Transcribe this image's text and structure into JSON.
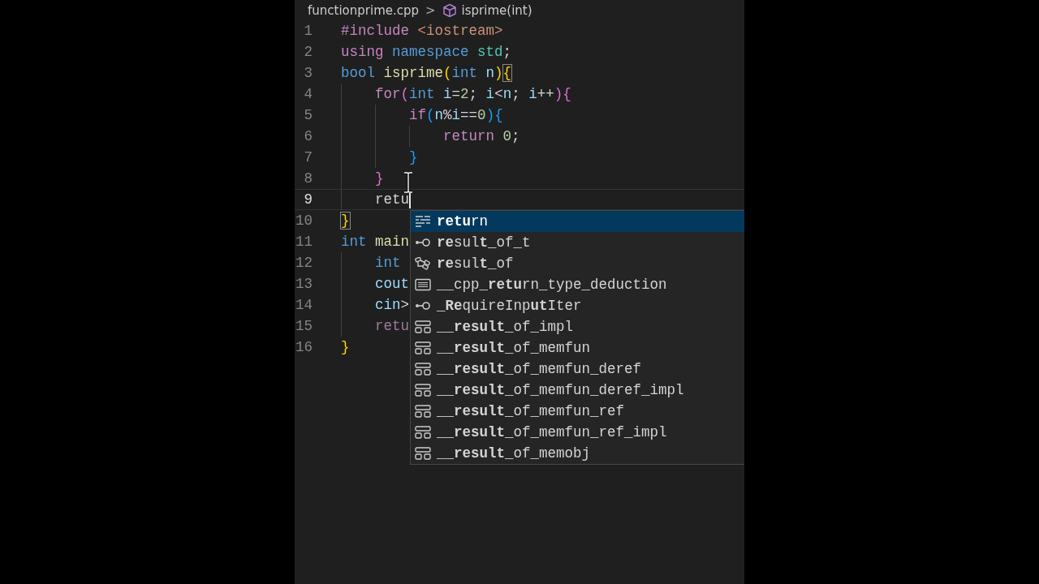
{
  "breadcrumb": {
    "file": "functionprime.cpp",
    "separator": ">",
    "symbol": "isprime(int)"
  },
  "lines": [
    {
      "number": "1",
      "current": false,
      "tokens": [
        {
          "text": "#include",
          "kind": "keyword"
        },
        {
          "text": " <iostream>",
          "kind": "string"
        }
      ]
    },
    {
      "number": "2",
      "current": false,
      "tokens": [
        {
          "text": "using",
          "kind": "keyword"
        },
        {
          "text": " namespace",
          "kind": "type"
        },
        {
          "text": " std",
          "kind": "namespace"
        },
        {
          "text": ";",
          "kind": "plain"
        }
      ]
    },
    {
      "number": "3",
      "current": false,
      "tokens": [
        {
          "text": "bool",
          "kind": "type"
        },
        {
          "text": " isprime",
          "kind": "function"
        },
        {
          "text": "(",
          "kind": "bracket1"
        },
        {
          "text": "int",
          "kind": "type"
        },
        {
          "text": " n",
          "kind": "variable"
        },
        {
          "text": ")",
          "kind": "bracket1"
        },
        {
          "text": "{",
          "kind": "matched-bracket"
        }
      ]
    },
    {
      "number": "4",
      "current": false,
      "tokens": [
        {
          "text": "    for",
          "kind": "keyword"
        },
        {
          "text": "(",
          "kind": "bracket2"
        },
        {
          "text": "int",
          "kind": "type"
        },
        {
          "text": " i",
          "kind": "variable"
        },
        {
          "text": "=",
          "kind": "plain"
        },
        {
          "text": "2",
          "kind": "number"
        },
        {
          "text": "; ",
          "kind": "plain"
        },
        {
          "text": "i",
          "kind": "variable"
        },
        {
          "text": "<",
          "kind": "plain"
        },
        {
          "text": "n",
          "kind": "variable"
        },
        {
          "text": "; ",
          "kind": "plain"
        },
        {
          "text": "i",
          "kind": "variable"
        },
        {
          "text": "++",
          "kind": "plain"
        },
        {
          "text": "){",
          "kind": "bracket2"
        }
      ]
    },
    {
      "number": "5",
      "current": false,
      "tokens": [
        {
          "text": "        if",
          "kind": "keyword"
        },
        {
          "text": "(",
          "kind": "bracket3"
        },
        {
          "text": "n",
          "kind": "variable"
        },
        {
          "text": "%",
          "kind": "plain"
        },
        {
          "text": "i",
          "kind": "variable"
        },
        {
          "text": "==",
          "kind": "plain"
        },
        {
          "text": "0",
          "kind": "number"
        },
        {
          "text": "){",
          "kind": "bracket3"
        }
      ]
    },
    {
      "number": "6",
      "current": false,
      "tokens": [
        {
          "text": "            return",
          "kind": "keyword"
        },
        {
          "text": " 0",
          "kind": "number"
        },
        {
          "text": ";",
          "kind": "plain"
        }
      ]
    },
    {
      "number": "7",
      "current": false,
      "tokens": [
        {
          "text": "        }",
          "kind": "bracket3"
        }
      ]
    },
    {
      "number": "8",
      "current": false,
      "tokens": [
        {
          "text": "    }",
          "kind": "bracket2"
        }
      ]
    },
    {
      "number": "9",
      "current": true,
      "tokens": [
        {
          "text": "    retu",
          "kind": "plain"
        }
      ]
    },
    {
      "number": "10",
      "current": false,
      "tokens": [
        {
          "text": "}",
          "kind": "matched-bracket"
        }
      ]
    },
    {
      "number": "11",
      "current": false,
      "tokens": [
        {
          "text": "int",
          "kind": "type"
        },
        {
          "text": " main",
          "kind": "function"
        }
      ]
    },
    {
      "number": "12",
      "current": false,
      "tokens": [
        {
          "text": "    int",
          "kind": "type"
        }
      ]
    },
    {
      "number": "13",
      "current": false,
      "tokens": [
        {
          "text": "    cout",
          "kind": "variable"
        }
      ]
    },
    {
      "number": "14",
      "current": false,
      "tokens": [
        {
          "text": "    cin",
          "kind": "variable"
        },
        {
          "text": ">",
          "kind": "plain"
        }
      ]
    },
    {
      "number": "15",
      "current": false,
      "tokens": [
        {
          "text": "    retu",
          "kind": "keyword-dim"
        }
      ]
    },
    {
      "number": "16",
      "current": false,
      "tokens": [
        {
          "text": "}",
          "kind": "bracket1"
        }
      ]
    }
  ],
  "suggestions": [
    {
      "label": "**retu**rn",
      "kind": "keyword",
      "selected": true
    },
    {
      "label": "**re**sul**t**_of_t",
      "kind": "typedef",
      "selected": false
    },
    {
      "label": "**re**sul**t**_of",
      "kind": "template",
      "selected": false
    },
    {
      "label": "__cpp_**retu**rn_type_deduction",
      "kind": "macro",
      "selected": false
    },
    {
      "label": "_**Re**quireInp**ut**Iter",
      "kind": "typedef",
      "selected": false
    },
    {
      "label": "__**result**_of_impl",
      "kind": "struct",
      "selected": false
    },
    {
      "label": "__**result**_of_memfun",
      "kind": "struct",
      "selected": false
    },
    {
      "label": "__**result**_of_memfun_deref",
      "kind": "struct",
      "selected": false
    },
    {
      "label": "__**result**_of_memfun_deref_impl",
      "kind": "struct",
      "selected": false
    },
    {
      "label": "__**result**_of_memfun_ref",
      "kind": "struct",
      "selected": false
    },
    {
      "label": "__**result**_of_memfun_ref_impl",
      "kind": "struct",
      "selected": false
    },
    {
      "label": "__**result**_of_memobj",
      "kind": "struct",
      "selected": false
    }
  ]
}
